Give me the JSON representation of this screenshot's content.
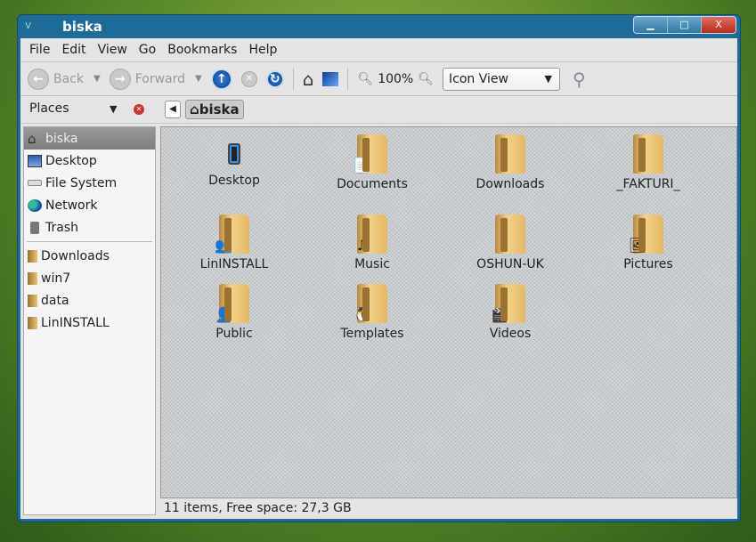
{
  "window": {
    "title": "biska"
  },
  "menu": [
    "File",
    "Edit",
    "View",
    "Go",
    "Bookmarks",
    "Help"
  ],
  "toolbar": {
    "back": "Back",
    "forward": "Forward",
    "zoom": "100%",
    "view_mode": "Icon View"
  },
  "location": {
    "places_label": "Places",
    "crumb": "biska"
  },
  "sidebar": {
    "places": [
      "biska",
      "Desktop",
      "File System",
      "Network",
      "Trash"
    ],
    "bookmarks": [
      "Downloads",
      "win7",
      "data",
      "LinINSTALL"
    ]
  },
  "files": [
    {
      "name": "Desktop",
      "icon": "phone-icon"
    },
    {
      "name": "Documents",
      "icon": "documents-folder-icon"
    },
    {
      "name": "Downloads",
      "icon": "downloads-folder-icon"
    },
    {
      "name": "_FAKTURI_",
      "icon": "folder-icon"
    },
    {
      "name": "LinINSTALL",
      "icon": "shared-folder-icon"
    },
    {
      "name": "Music",
      "icon": "music-folder-icon"
    },
    {
      "name": "OSHUN-UK",
      "icon": "folder-icon"
    },
    {
      "name": "Pictures",
      "icon": "pictures-folder-icon"
    },
    {
      "name": "Public",
      "icon": "public-folder-icon"
    },
    {
      "name": "Templates",
      "icon": "templates-folder-icon"
    },
    {
      "name": "Videos",
      "icon": "videos-folder-icon"
    }
  ],
  "status": "11 items, Free space: 27,3 GB"
}
